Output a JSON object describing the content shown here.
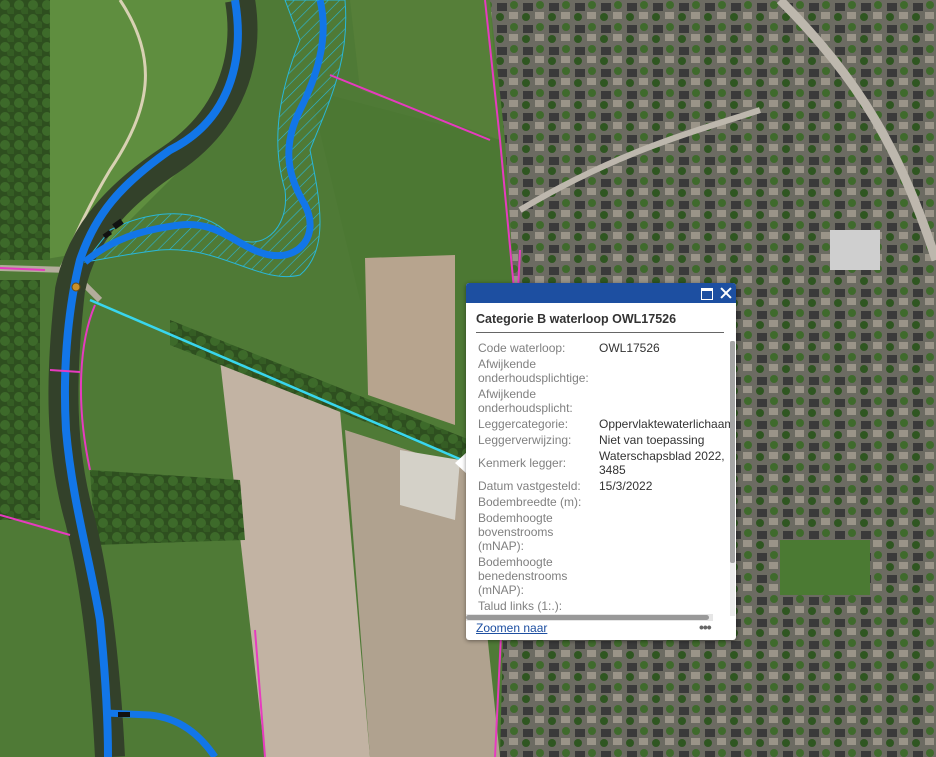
{
  "map": {
    "colors": {
      "river": "#1276e8",
      "ditch_hatch": "#2ab7d8",
      "parcel_line": "#e63bbf",
      "selected_waterway": "#39d6ee",
      "meadow": "#4f7a36",
      "field_bare": "#b9aa97",
      "town": "#6e6a60"
    }
  },
  "popup": {
    "title": "Categorie B waterloop OWL17526",
    "attributes": [
      {
        "label": "Code waterloop:",
        "value": "OWL17526"
      },
      {
        "label": "Afwijkende onderhoudsplichtige:",
        "value": ""
      },
      {
        "label": "Afwijkende onderhoudsplicht:",
        "value": ""
      },
      {
        "label": "Leggercategorie:",
        "value": "Oppervlaktewaterlichaam"
      },
      {
        "label": "Leggerverwijzing:",
        "value": "Niet van toepassing"
      },
      {
        "label": "Kenmerk legger:",
        "value": "Waterschapsblad 2022, 3485"
      },
      {
        "label": "Datum vastgesteld:",
        "value": "15/3/2022"
      },
      {
        "label": "Bodembreedte (m):",
        "value": ""
      },
      {
        "label": "Bodemhoogte bovenstrooms (mNAP):",
        "value": ""
      },
      {
        "label": "Bodemhoogte benedenstrooms (mNAP):",
        "value": ""
      },
      {
        "label": "Talud links (1:.):",
        "value": ""
      }
    ],
    "zoom_link": "Zoomen naar",
    "more_label": "•••",
    "maximize_icon": "maximize-icon",
    "close_icon": "close-icon"
  }
}
